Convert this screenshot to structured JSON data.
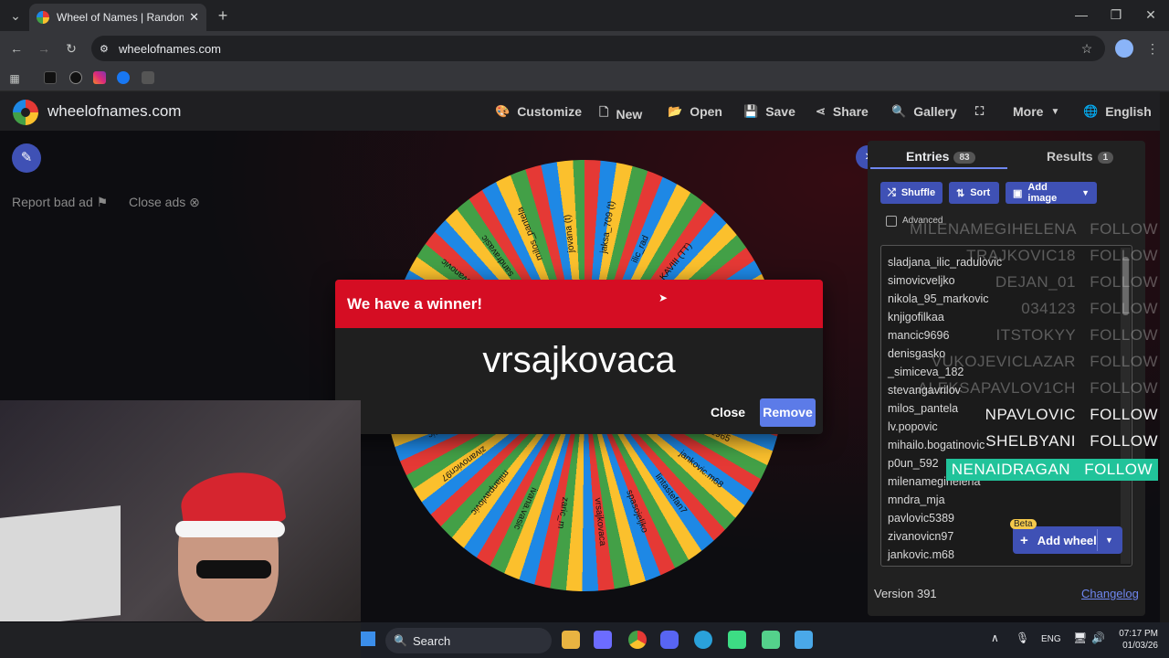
{
  "browser": {
    "tab_title": "Wheel of Names | Random nam",
    "url": "wheelofnames.com"
  },
  "site": {
    "title": "wheelofnames.com",
    "nav": [
      "Customize",
      "New",
      "Open",
      "Save",
      "Share",
      "Gallery",
      "More",
      "English"
    ],
    "report_ad": "Report bad ad",
    "close_ads": "Close ads"
  },
  "dialog": {
    "title": "We have a winner!",
    "winner": "vrsajkovaca",
    "close_label": "Close",
    "remove_label": "Remove"
  },
  "panel": {
    "tab_entries": "Entries",
    "entries_count": "83",
    "tab_results": "Results",
    "results_count": "1",
    "shuffle": "Shuffle",
    "sort": "Sort",
    "add_image": "Add image",
    "advanced": "Advanced",
    "entries": [
      "sladjana_ilic_radulovic",
      "simovicveljko",
      "nikola_95_markovic",
      "knjigofilkaa",
      "mancic9696",
      "denisgasko",
      "_simiceva_182",
      "stevangavrilov",
      "milos_pantela",
      "lv.popovic",
      "mihailo.bogatinovic",
      "p0un_592",
      "milenamegihelena",
      "mndra_mja",
      "pavlovic5389",
      "zivanovicn97",
      "jankovic.m68"
    ],
    "beta": "Beta",
    "add_wheel": "Add wheel",
    "version": "Version 391",
    "changelog": "Changelog"
  },
  "overlay": [
    {
      "name": "MILENAMEGIHELENA",
      "action": "FOLLOW",
      "style": "dim"
    },
    {
      "name": "TRAJKOVIC18",
      "action": "FOLLOW",
      "style": "dim"
    },
    {
      "name": "DEJAN_01",
      "action": "FOLLOW",
      "style": "dim"
    },
    {
      "name": "034123",
      "action": "FOLLOW",
      "style": "dim"
    },
    {
      "name": "ITSTOKYY",
      "action": "FOLLOW",
      "style": "dim"
    },
    {
      "name": "VUKOJEVICLAZAR",
      "action": "FOLLOW",
      "style": "dim"
    },
    {
      "name": "ALEKSAPAVLOV1CH",
      "action": "FOLLOW",
      "style": "dim"
    },
    {
      "name": "NPAVLOVIC",
      "action": "FOLLOW",
      "style": "bright"
    },
    {
      "name": "SHELBYANI",
      "action": "FOLLOW",
      "style": "bright"
    },
    {
      "name": "NENAIDRAGAN",
      "action": "FOLLOW",
      "style": "hl"
    }
  ],
  "wheel_labels": [
    "jovana (t)",
    "jaksa_709 (t)",
    "ilic_rad",
    "KAVIII (TT)",
    "bojic (t)",
    "rosic_vanja",
    "natali_jelena",
    "angelo",
    "1571965",
    "jankovic.m68",
    "lintastefan7",
    "spasojeljko",
    "vrsajkovaca",
    "zaric_m",
    "ivana.vasic",
    "milanpavlovic",
    "zivanovicn97",
    "zora_cupic",
    "jelavidovic",
    "stefan.koste",
    "dejanmilan",
    "milosjovanovic",
    "sandravasic",
    "milos_pantela"
  ],
  "taskbar": {
    "search": "Search",
    "lang": "ENG",
    "time": "07:17 PM",
    "date": "01/03/26"
  }
}
